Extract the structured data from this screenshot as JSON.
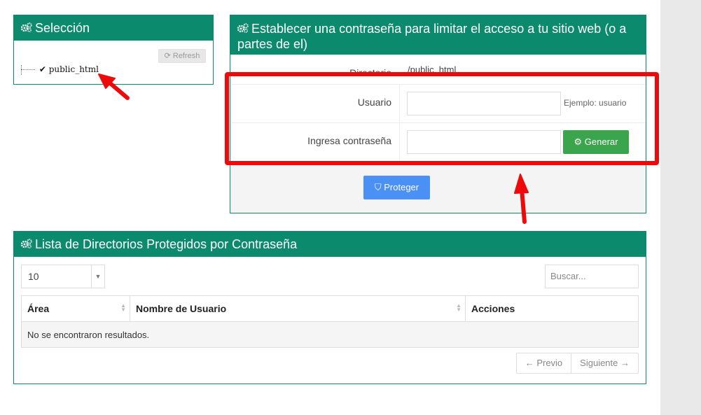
{
  "selection": {
    "title": "Selección",
    "refresh_label": "Refresh",
    "tree_item": "public_html"
  },
  "protect": {
    "title": "Establecer una contraseña para limitar el acceso a tu sitio web (o a partes de el)",
    "directory_label": "Directorio",
    "directory_value": "/public_html",
    "user_label": "Usuario",
    "user_value": "",
    "user_hint": "Ejemplo: usuario",
    "password_label": "Ingresa contraseña",
    "password_value": "",
    "generate_label": "Generar",
    "protect_label": "Proteger"
  },
  "list": {
    "title": "Lista de Directorios Protegidos por Contraseña",
    "page_length": "10",
    "search_placeholder": "Buscar...",
    "columns": [
      "Área",
      "Nombre de Usuario",
      "Acciones"
    ],
    "empty_message": "No se encontraron resultados.",
    "prev_label": "← Previo",
    "next_label": "Siguiente →"
  },
  "colors": {
    "header_green": "#0c8a6d",
    "generate_green": "#3aa54c",
    "protect_blue": "#4a90f5",
    "annotation_red": "#ee0a0a"
  }
}
